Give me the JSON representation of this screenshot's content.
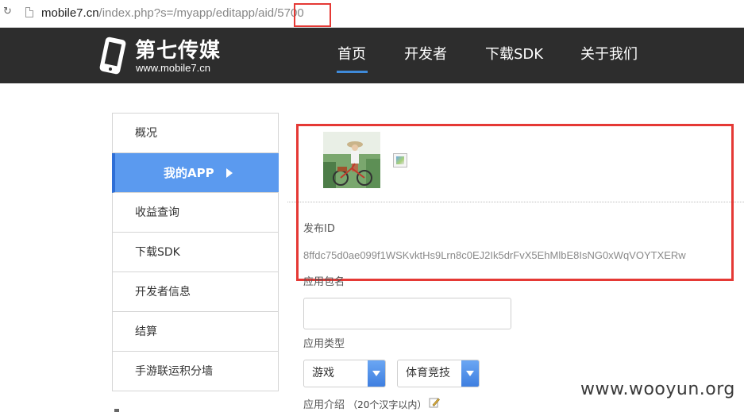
{
  "browser": {
    "url_host": "mobile7.cn",
    "url_path_prefix": "/index.php?s=/myapp/editapp/aid/",
    "url_id": "5700"
  },
  "header": {
    "logo_name": "第七传媒",
    "logo_domain": "www.mobile7.cn",
    "nav": [
      {
        "label": "首页",
        "active": true
      },
      {
        "label": "开发者",
        "active": false
      },
      {
        "label": "下载SDK",
        "active": false
      },
      {
        "label": "关于我们",
        "active": false
      }
    ]
  },
  "sidebar": {
    "items": [
      {
        "label": "概况",
        "active": false
      },
      {
        "label": "我的APP",
        "active": true
      },
      {
        "label": "收益查询",
        "active": false
      },
      {
        "label": "下载SDK",
        "active": false
      },
      {
        "label": "开发者信息",
        "active": false
      },
      {
        "label": "结算",
        "active": false
      },
      {
        "label": "手游联运积分墙",
        "active": false
      }
    ]
  },
  "main": {
    "publish_id_label": "发布ID",
    "publish_id_value": "8ffdc75d0ae099f1WSKvktHs9Lrn8c0EJ2Ik5drFvX5EhMlbE8IsNG0xWqVOYTXERw",
    "package_label": "应用包名",
    "package_value": "",
    "app_type_label": "应用类型",
    "type_select": "游戏",
    "subtype_select": "体育竞技",
    "intro_label": "应用介绍",
    "intro_note": "（20个汉字以内）"
  },
  "watermark": "www.wooyun.org",
  "colors": {
    "header_bg": "#2d2d2d",
    "nav_active": "#3f8ad9",
    "sidebar_active": "#5b9aef",
    "highlight_red": "#e53935"
  }
}
